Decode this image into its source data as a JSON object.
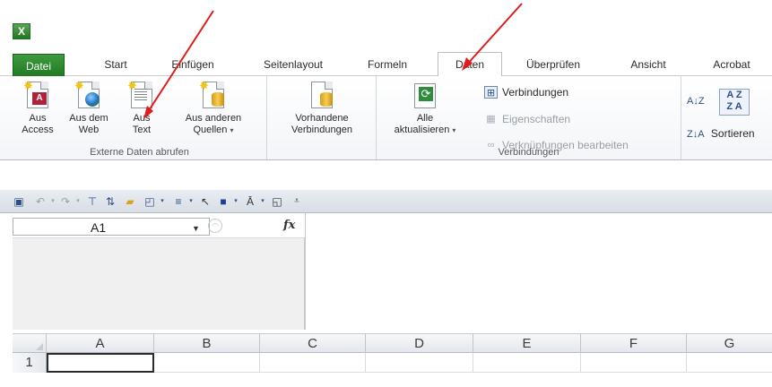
{
  "tabs": [
    "Datei",
    "Start",
    "Einfügen",
    "Seitenlayout",
    "Formeln",
    "Daten",
    "Überprüfen",
    "Ansicht",
    "Acrobat"
  ],
  "active_tab": "Daten",
  "ribbon": {
    "external": {
      "label": "Externe Daten abrufen",
      "access": [
        "Aus",
        "Access"
      ],
      "web": [
        "Aus dem",
        "Web"
      ],
      "text": [
        "Aus",
        "Text"
      ],
      "other": [
        "Aus anderen",
        "Quellen"
      ]
    },
    "existing": [
      "Vorhandene",
      "Verbindungen"
    ],
    "connections": {
      "label": "Verbindungen",
      "refresh": [
        "Alle",
        "aktualisieren"
      ],
      "connections": "Verbindungen",
      "properties": "Eigenschaften",
      "edit_links": "Verknüpfungen bearbeiten"
    },
    "sort": {
      "az": "A↓Z",
      "za": "Z↓A",
      "sort_label": "Sortieren"
    }
  },
  "formula_bar": {
    "name_box": "A1",
    "fx": "fx"
  },
  "grid": {
    "columns": [
      "A",
      "B",
      "C",
      "D",
      "E",
      "F",
      "G"
    ],
    "rows": [
      "1"
    ]
  },
  "colors": {
    "file_tab": "#217a21",
    "arrow": "#e01b1b"
  }
}
